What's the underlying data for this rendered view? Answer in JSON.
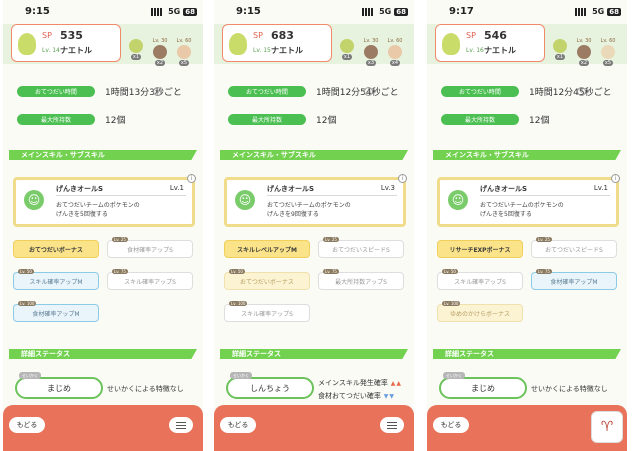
{
  "screens": [
    {
      "time": "9:15",
      "net": "5G",
      "battery": "68",
      "sp_label": "SP",
      "sp_value": "535",
      "level": "Lv. 14",
      "name": "ナエトル",
      "berries": [
        {
          "level": "",
          "count": "x1",
          "color": "#c3d36b"
        },
        {
          "level": "Lv. 30",
          "count": "x2",
          "color": "#9b7b63"
        },
        {
          "level": "Lv. 60",
          "count": "x5",
          "color": "#e9c9a8"
        }
      ],
      "help_label": "おてつだい時間",
      "help_value": "1時間13分3秒ごと",
      "max_label": "最大所持数",
      "max_value": "12個",
      "section_skill": "メインスキル・サブスキル",
      "skill_name": "げんきオールS",
      "skill_level": "Lv.1",
      "skill_desc": "おてつだいチームのポケモンの\nげんきを5回復する",
      "subskills": [
        {
          "label": "おてつだいボーナス",
          "tag": "Lv. 10",
          "style": "gold"
        },
        {
          "label": "食材確率アップS",
          "tag": "Lv. 25",
          "style": "white"
        },
        {
          "label": "スキル確率アップM",
          "tag": "Lv. 50",
          "style": "blue"
        },
        {
          "label": "スキル確率アップS",
          "tag": "Lv. 75",
          "style": "white"
        },
        {
          "label": "食材確率アップM",
          "tag": "Lv. 100",
          "style": "blue"
        }
      ],
      "section_status": "詳細ステータス",
      "nature_tag": "せいかく",
      "nature": "まじめ",
      "nature_desc_1": "せいかくによる特徴なし",
      "nature_desc_2": "",
      "back_label": "もどる"
    },
    {
      "time": "9:15",
      "net": "5G",
      "battery": "68",
      "sp_label": "SP",
      "sp_value": "683",
      "level": "Lv. 15",
      "name": "ナエトル",
      "berries": [
        {
          "level": "",
          "count": "x1",
          "color": "#c3d36b"
        },
        {
          "level": "Lv. 30",
          "count": "x3",
          "color": "#9b7b63"
        },
        {
          "level": "Lv. 60",
          "count": "x4",
          "color": "#e9c9a8"
        }
      ],
      "help_label": "おてつだい時間",
      "help_value": "1時間12分54秒ごと",
      "max_label": "最大所持数",
      "max_value": "12個",
      "section_skill": "メインスキル・サブスキル",
      "skill_name": "げんきオールS",
      "skill_level": "Lv.3",
      "skill_desc": "おてつだいチームのポケモンの\nげんきを9回復する",
      "subskills": [
        {
          "label": "スキルレベルアップM",
          "tag": "Lv. 10",
          "style": "gold"
        },
        {
          "label": "おてつだいスピードS",
          "tag": "Lv. 25",
          "style": "white"
        },
        {
          "label": "おてつだいボーナス",
          "tag": "Lv. 50",
          "style": "pale"
        },
        {
          "label": "最大所持数アップS",
          "tag": "Lv. 75",
          "style": "white"
        },
        {
          "label": "スキル確率アップS",
          "tag": "Lv. 100",
          "style": "white"
        }
      ],
      "section_status": "詳細ステータス",
      "nature_tag": "せいかく",
      "nature": "しんちょう",
      "nature_desc_1": "メインスキル発生確率",
      "nature_desc_2": "食材おてつだい確率",
      "back_label": "もどる"
    },
    {
      "time": "9:17",
      "net": "5G",
      "battery": "68",
      "sp_label": "SP",
      "sp_value": "546",
      "level": "Lv. 16",
      "name": "ナエトル",
      "berries": [
        {
          "level": "",
          "count": "x1",
          "color": "#c3d36b"
        },
        {
          "level": "Lv. 30",
          "count": "x2",
          "color": "#9b7b63"
        },
        {
          "level": "Lv. 60",
          "count": "x5",
          "color": "#e9d9b8"
        }
      ],
      "help_label": "おてつだい時間",
      "help_value": "1時間12分45秒ごと",
      "max_label": "最大所持数",
      "max_value": "12個",
      "section_skill": "メインスキル・サブスキル",
      "skill_name": "げんきオールS",
      "skill_level": "Lv.1",
      "skill_desc": "おてつだいチームのポケモンの\nげんきを5回復する",
      "subskills": [
        {
          "label": "リサーチEXPボーナス",
          "tag": "Lv. 10",
          "style": "gold"
        },
        {
          "label": "おてつだいスピードS",
          "tag": "Lv. 25",
          "style": "white"
        },
        {
          "label": "スキル確率アップS",
          "tag": "Lv. 50",
          "style": "white"
        },
        {
          "label": "食材確率アップM",
          "tag": "Lv. 75",
          "style": "blue"
        },
        {
          "label": "ゆめのかけらボーナス",
          "tag": "Lv. 100",
          "style": "pale"
        }
      ],
      "section_status": "詳細ステータス",
      "nature_tag": "せいかく",
      "nature": "まじめ",
      "nature_desc_1": "せいかくによる特徴なし",
      "nature_desc_2": "",
      "back_label": "もどる"
    }
  ]
}
